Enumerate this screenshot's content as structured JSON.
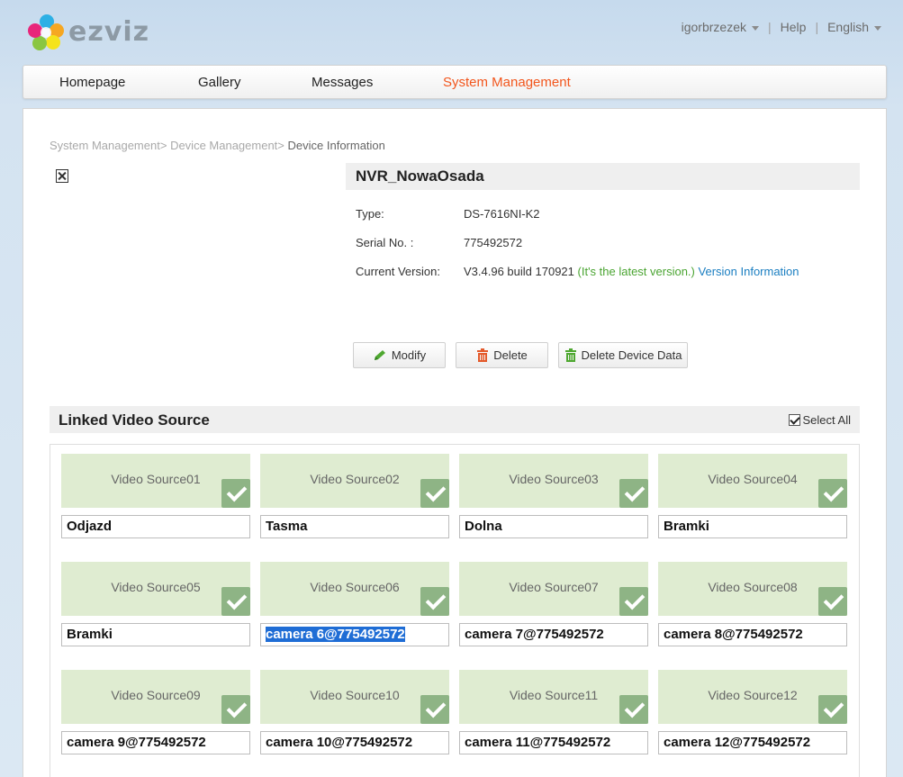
{
  "header": {
    "logo_text": "ezviz",
    "user": "igorbrzezek",
    "help": "Help",
    "language": "English"
  },
  "nav": {
    "tabs": [
      {
        "label": "Homepage"
      },
      {
        "label": "Gallery"
      },
      {
        "label": "Messages"
      },
      {
        "label": "System Management"
      }
    ],
    "active": "System Management"
  },
  "breadcrumb": {
    "item1": "System Management",
    "sep1": ">",
    "item2": "Device Management",
    "sep2": ">",
    "current": "Device Information"
  },
  "device": {
    "name": "NVR_NowaOsada",
    "type_label": "Type:",
    "type_value": "DS-7616NI-K2",
    "serial_label": "Serial No. :",
    "serial_value": "775492572",
    "version_label": "Current Version:",
    "version_value": "V3.4.96 build 170921",
    "version_latest": "(It's the latest version.)",
    "version_info_link": "Version Information"
  },
  "actions": {
    "modify": "Modify",
    "delete": "Delete",
    "delete_data": "Delete Device Data"
  },
  "linked": {
    "title": "Linked Video Source",
    "select_all": "Select All",
    "sources": [
      {
        "source": "Video Source01",
        "name": "Odjazd"
      },
      {
        "source": "Video Source02",
        "name": "Tasma"
      },
      {
        "source": "Video Source03",
        "name": "Dolna"
      },
      {
        "source": "Video Source04",
        "name": "Bramki"
      },
      {
        "source": "Video Source05",
        "name": "Bramki"
      },
      {
        "source": "Video Source06",
        "name": "camera 6@775492572"
      },
      {
        "source": "Video Source07",
        "name": "camera 7@775492572"
      },
      {
        "source": "Video Source08",
        "name": "camera 8@775492572"
      },
      {
        "source": "Video Source09",
        "name": "camera 9@775492572"
      },
      {
        "source": "Video Source10",
        "name": "camera 10@775492572"
      },
      {
        "source": "Video Source11",
        "name": "camera 11@775492572"
      },
      {
        "source": "Video Source12",
        "name": "camera 12@775492572"
      }
    ]
  },
  "colors": {
    "accent": "#f2561d",
    "tile_bg": "#dfecd1",
    "check_bg": "#8eb485",
    "link": "#1a7ec1",
    "latest": "#4aa431"
  }
}
